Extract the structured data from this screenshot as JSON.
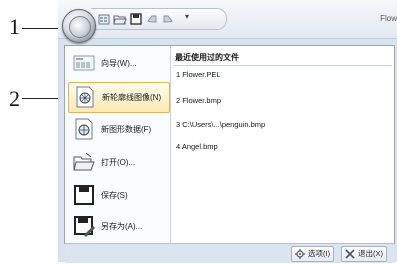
{
  "callouts": {
    "one": "1",
    "two": "2"
  },
  "window": {
    "title_partial": "Flow",
    "qat_dropdown": "▾"
  },
  "menu": {
    "items": [
      {
        "label": "向导(W)..."
      },
      {
        "label": "新轮廓线图像(N)"
      },
      {
        "label": "新图形数据(F)"
      },
      {
        "label": "打开(O)..."
      },
      {
        "label": "保存(S)"
      },
      {
        "label": "另存为(A)..."
      }
    ],
    "recent_title": "最近使用过的文件",
    "recent": [
      "1 Flower.PEL",
      "2 Flower.bmp",
      "3 C:\\Users\\...\\penguin.bmp",
      "4 Angel.bmp"
    ],
    "buttons": {
      "options": "选项(I)",
      "exit": "退出(X)"
    }
  }
}
